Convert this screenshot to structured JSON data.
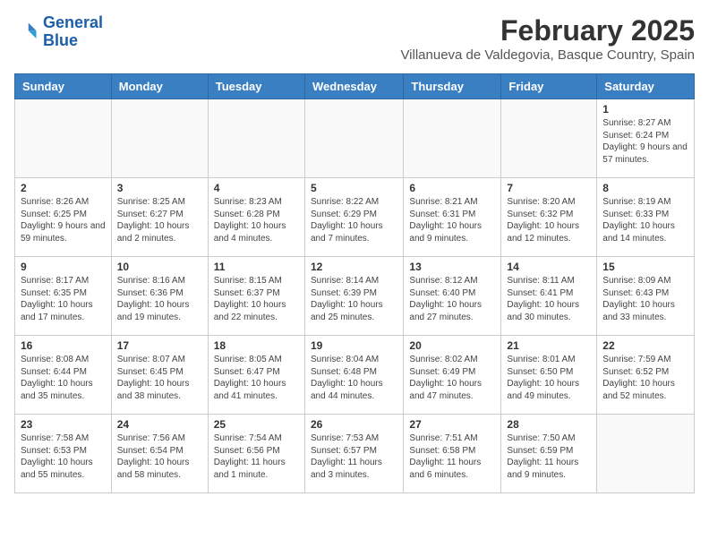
{
  "logo": {
    "line1": "General",
    "line2": "Blue"
  },
  "title": "February 2025",
  "location": "Villanueva de Valdegovia, Basque Country, Spain",
  "weekdays": [
    "Sunday",
    "Monday",
    "Tuesday",
    "Wednesday",
    "Thursday",
    "Friday",
    "Saturday"
  ],
  "weeks": [
    [
      {
        "day": "",
        "sunrise": "",
        "sunset": "",
        "daylight": ""
      },
      {
        "day": "",
        "sunrise": "",
        "sunset": "",
        "daylight": ""
      },
      {
        "day": "",
        "sunrise": "",
        "sunset": "",
        "daylight": ""
      },
      {
        "day": "",
        "sunrise": "",
        "sunset": "",
        "daylight": ""
      },
      {
        "day": "",
        "sunrise": "",
        "sunset": "",
        "daylight": ""
      },
      {
        "day": "",
        "sunrise": "",
        "sunset": "",
        "daylight": ""
      },
      {
        "day": "1",
        "sunrise": "Sunrise: 8:27 AM",
        "sunset": "Sunset: 6:24 PM",
        "daylight": "Daylight: 9 hours and 57 minutes."
      }
    ],
    [
      {
        "day": "2",
        "sunrise": "Sunrise: 8:26 AM",
        "sunset": "Sunset: 6:25 PM",
        "daylight": "Daylight: 9 hours and 59 minutes."
      },
      {
        "day": "3",
        "sunrise": "Sunrise: 8:25 AM",
        "sunset": "Sunset: 6:27 PM",
        "daylight": "Daylight: 10 hours and 2 minutes."
      },
      {
        "day": "4",
        "sunrise": "Sunrise: 8:23 AM",
        "sunset": "Sunset: 6:28 PM",
        "daylight": "Daylight: 10 hours and 4 minutes."
      },
      {
        "day": "5",
        "sunrise": "Sunrise: 8:22 AM",
        "sunset": "Sunset: 6:29 PM",
        "daylight": "Daylight: 10 hours and 7 minutes."
      },
      {
        "day": "6",
        "sunrise": "Sunrise: 8:21 AM",
        "sunset": "Sunset: 6:31 PM",
        "daylight": "Daylight: 10 hours and 9 minutes."
      },
      {
        "day": "7",
        "sunrise": "Sunrise: 8:20 AM",
        "sunset": "Sunset: 6:32 PM",
        "daylight": "Daylight: 10 hours and 12 minutes."
      },
      {
        "day": "8",
        "sunrise": "Sunrise: 8:19 AM",
        "sunset": "Sunset: 6:33 PM",
        "daylight": "Daylight: 10 hours and 14 minutes."
      }
    ],
    [
      {
        "day": "9",
        "sunrise": "Sunrise: 8:17 AM",
        "sunset": "Sunset: 6:35 PM",
        "daylight": "Daylight: 10 hours and 17 minutes."
      },
      {
        "day": "10",
        "sunrise": "Sunrise: 8:16 AM",
        "sunset": "Sunset: 6:36 PM",
        "daylight": "Daylight: 10 hours and 19 minutes."
      },
      {
        "day": "11",
        "sunrise": "Sunrise: 8:15 AM",
        "sunset": "Sunset: 6:37 PM",
        "daylight": "Daylight: 10 hours and 22 minutes."
      },
      {
        "day": "12",
        "sunrise": "Sunrise: 8:14 AM",
        "sunset": "Sunset: 6:39 PM",
        "daylight": "Daylight: 10 hours and 25 minutes."
      },
      {
        "day": "13",
        "sunrise": "Sunrise: 8:12 AM",
        "sunset": "Sunset: 6:40 PM",
        "daylight": "Daylight: 10 hours and 27 minutes."
      },
      {
        "day": "14",
        "sunrise": "Sunrise: 8:11 AM",
        "sunset": "Sunset: 6:41 PM",
        "daylight": "Daylight: 10 hours and 30 minutes."
      },
      {
        "day": "15",
        "sunrise": "Sunrise: 8:09 AM",
        "sunset": "Sunset: 6:43 PM",
        "daylight": "Daylight: 10 hours and 33 minutes."
      }
    ],
    [
      {
        "day": "16",
        "sunrise": "Sunrise: 8:08 AM",
        "sunset": "Sunset: 6:44 PM",
        "daylight": "Daylight: 10 hours and 35 minutes."
      },
      {
        "day": "17",
        "sunrise": "Sunrise: 8:07 AM",
        "sunset": "Sunset: 6:45 PM",
        "daylight": "Daylight: 10 hours and 38 minutes."
      },
      {
        "day": "18",
        "sunrise": "Sunrise: 8:05 AM",
        "sunset": "Sunset: 6:47 PM",
        "daylight": "Daylight: 10 hours and 41 minutes."
      },
      {
        "day": "19",
        "sunrise": "Sunrise: 8:04 AM",
        "sunset": "Sunset: 6:48 PM",
        "daylight": "Daylight: 10 hours and 44 minutes."
      },
      {
        "day": "20",
        "sunrise": "Sunrise: 8:02 AM",
        "sunset": "Sunset: 6:49 PM",
        "daylight": "Daylight: 10 hours and 47 minutes."
      },
      {
        "day": "21",
        "sunrise": "Sunrise: 8:01 AM",
        "sunset": "Sunset: 6:50 PM",
        "daylight": "Daylight: 10 hours and 49 minutes."
      },
      {
        "day": "22",
        "sunrise": "Sunrise: 7:59 AM",
        "sunset": "Sunset: 6:52 PM",
        "daylight": "Daylight: 10 hours and 52 minutes."
      }
    ],
    [
      {
        "day": "23",
        "sunrise": "Sunrise: 7:58 AM",
        "sunset": "Sunset: 6:53 PM",
        "daylight": "Daylight: 10 hours and 55 minutes."
      },
      {
        "day": "24",
        "sunrise": "Sunrise: 7:56 AM",
        "sunset": "Sunset: 6:54 PM",
        "daylight": "Daylight: 10 hours and 58 minutes."
      },
      {
        "day": "25",
        "sunrise": "Sunrise: 7:54 AM",
        "sunset": "Sunset: 6:56 PM",
        "daylight": "Daylight: 11 hours and 1 minute."
      },
      {
        "day": "26",
        "sunrise": "Sunrise: 7:53 AM",
        "sunset": "Sunset: 6:57 PM",
        "daylight": "Daylight: 11 hours and 3 minutes."
      },
      {
        "day": "27",
        "sunrise": "Sunrise: 7:51 AM",
        "sunset": "Sunset: 6:58 PM",
        "daylight": "Daylight: 11 hours and 6 minutes."
      },
      {
        "day": "28",
        "sunrise": "Sunrise: 7:50 AM",
        "sunset": "Sunset: 6:59 PM",
        "daylight": "Daylight: 11 hours and 9 minutes."
      },
      {
        "day": "",
        "sunrise": "",
        "sunset": "",
        "daylight": ""
      }
    ]
  ]
}
